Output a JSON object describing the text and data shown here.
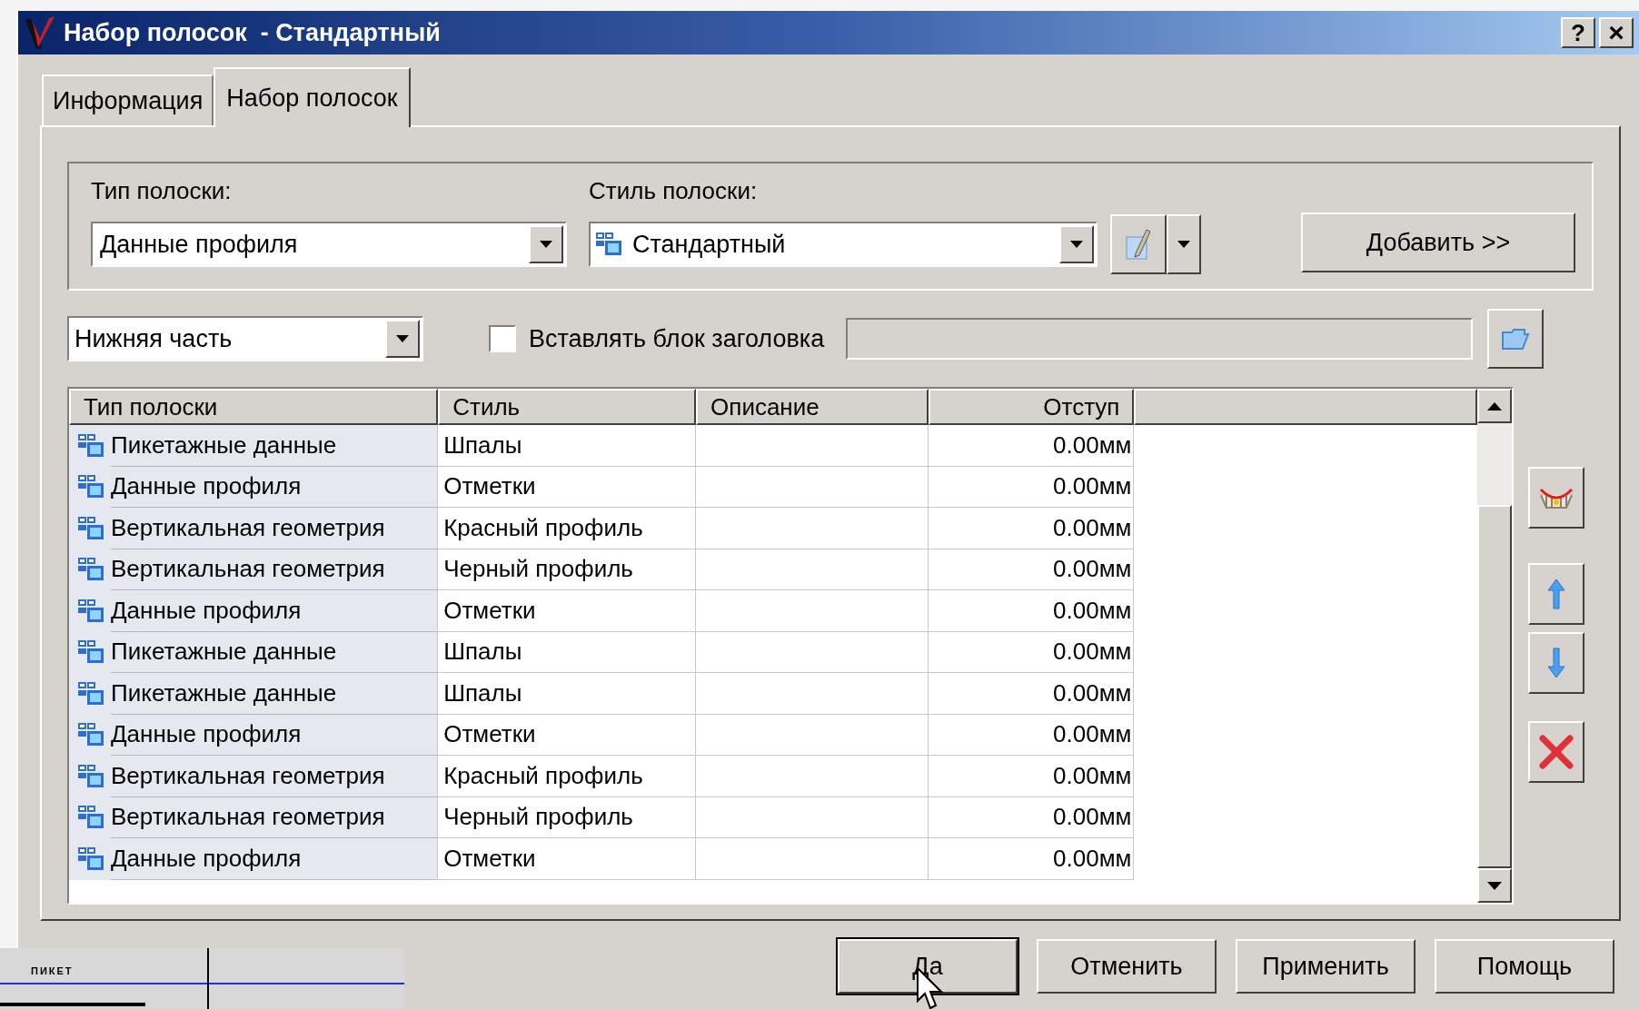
{
  "window": {
    "title": "Набор полосок  - Стандартный",
    "help_button": "?",
    "close_button": "×"
  },
  "tabs": [
    {
      "label": "Информация",
      "selected": false
    },
    {
      "label": "Набор полосок",
      "selected": true
    }
  ],
  "band_group": {
    "type_label": "Тип полоски:",
    "type_value": "Данные профиля",
    "style_label": "Стиль полоски:",
    "style_value": "Стандартный",
    "add_button": "Добавить >>"
  },
  "location": {
    "value": "Нижняя часть"
  },
  "header_block": {
    "label": "Вставлять блок заголовка",
    "checked": false
  },
  "table": {
    "columns": [
      "Тип полоски",
      "Стиль",
      "Описание",
      "Отступ"
    ],
    "rows": [
      {
        "type": "Пикетажные данные",
        "style": "Шпалы",
        "offset": "0.00мм"
      },
      {
        "type": "Данные профиля",
        "style": "Отметки",
        "offset": "0.00мм"
      },
      {
        "type": "Вертикальная геометрия",
        "style": "Красный профиль",
        "offset": "0.00мм"
      },
      {
        "type": "Вертикальная геометрия",
        "style": "Черный профиль",
        "offset": "0.00мм"
      },
      {
        "type": "Данные профиля",
        "style": "Отметки",
        "offset": "0.00мм"
      },
      {
        "type": "Пикетажные данные",
        "style": "Шпалы",
        "offset": "0.00мм"
      },
      {
        "type": "Пикетажные данные",
        "style": "Шпалы",
        "offset": "0.00мм"
      },
      {
        "type": "Данные профиля",
        "style": "Отметки",
        "offset": "0.00мм"
      },
      {
        "type": "Вертикальная геометрия",
        "style": "Красный профиль",
        "offset": "0.00мм"
      },
      {
        "type": "Вертикальная геометрия",
        "style": "Черный профиль",
        "offset": "0.00мм"
      },
      {
        "type": "Данные профиля",
        "style": "Отметки",
        "offset": "0.00мм"
      }
    ]
  },
  "dialog_buttons": [
    {
      "label": "Да",
      "default": true
    },
    {
      "label": "Отменить",
      "default": false
    },
    {
      "label": "Применить",
      "default": false
    },
    {
      "label": "Помощь",
      "default": false
    }
  ],
  "background_drawing": {
    "label": "ПИКЕТ"
  }
}
